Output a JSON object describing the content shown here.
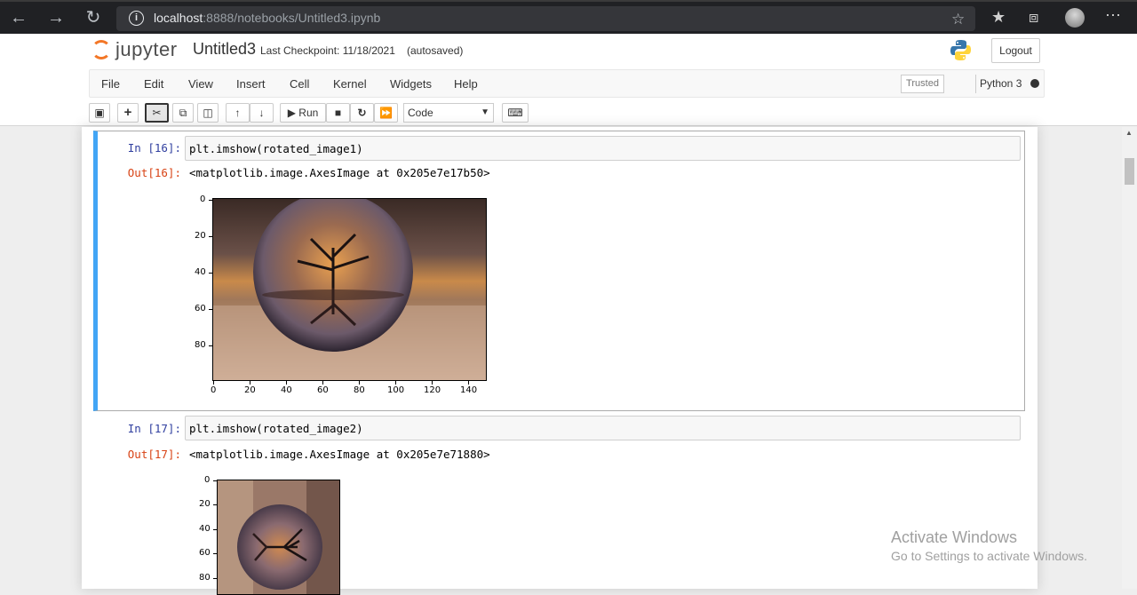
{
  "browser": {
    "url_host": "localhost",
    "url_path": ":8888/notebooks/Untitled3.ipynb",
    "icons": [
      "back-icon",
      "forward-icon",
      "refresh-icon",
      "info-icon",
      "favorite-add-icon",
      "favorites-icon",
      "collections-icon",
      "profile-icon",
      "more-icon"
    ]
  },
  "header": {
    "logo_text": "jupyter",
    "title": "Untitled3",
    "checkpoint": "Last Checkpoint: 11/18/2021",
    "autosave": "(autosaved)",
    "logout_label": "Logout"
  },
  "menu": {
    "items": [
      "File",
      "Edit",
      "View",
      "Insert",
      "Cell",
      "Kernel",
      "Widgets",
      "Help"
    ],
    "trusted": "Trusted",
    "kernel": "Python 3"
  },
  "toolbar": {
    "run_label": "Run",
    "cell_type": "Code"
  },
  "cells": [
    {
      "in_prompt": "In [16]:",
      "code": "plt.imshow(rotated_image1)",
      "out_prompt": "Out[16]:",
      "output": "<matplotlib.image.AxesImage at 0x205e7e17b50>",
      "yticks": [
        "0",
        "20",
        "40",
        "60",
        "80"
      ],
      "xticks": [
        "0",
        "20",
        "40",
        "60",
        "80",
        "100",
        "120",
        "140"
      ]
    },
    {
      "in_prompt": "In [17]:",
      "code": "plt.imshow(rotated_image2)",
      "out_prompt": "Out[17]:",
      "output": "<matplotlib.image.AxesImage at 0x205e7e71880>",
      "yticks": [
        "0",
        "20",
        "40",
        "60",
        "80"
      ]
    }
  ],
  "watermark": {
    "line1": "Activate Windows",
    "line2": "Go to Settings to activate Windows."
  }
}
